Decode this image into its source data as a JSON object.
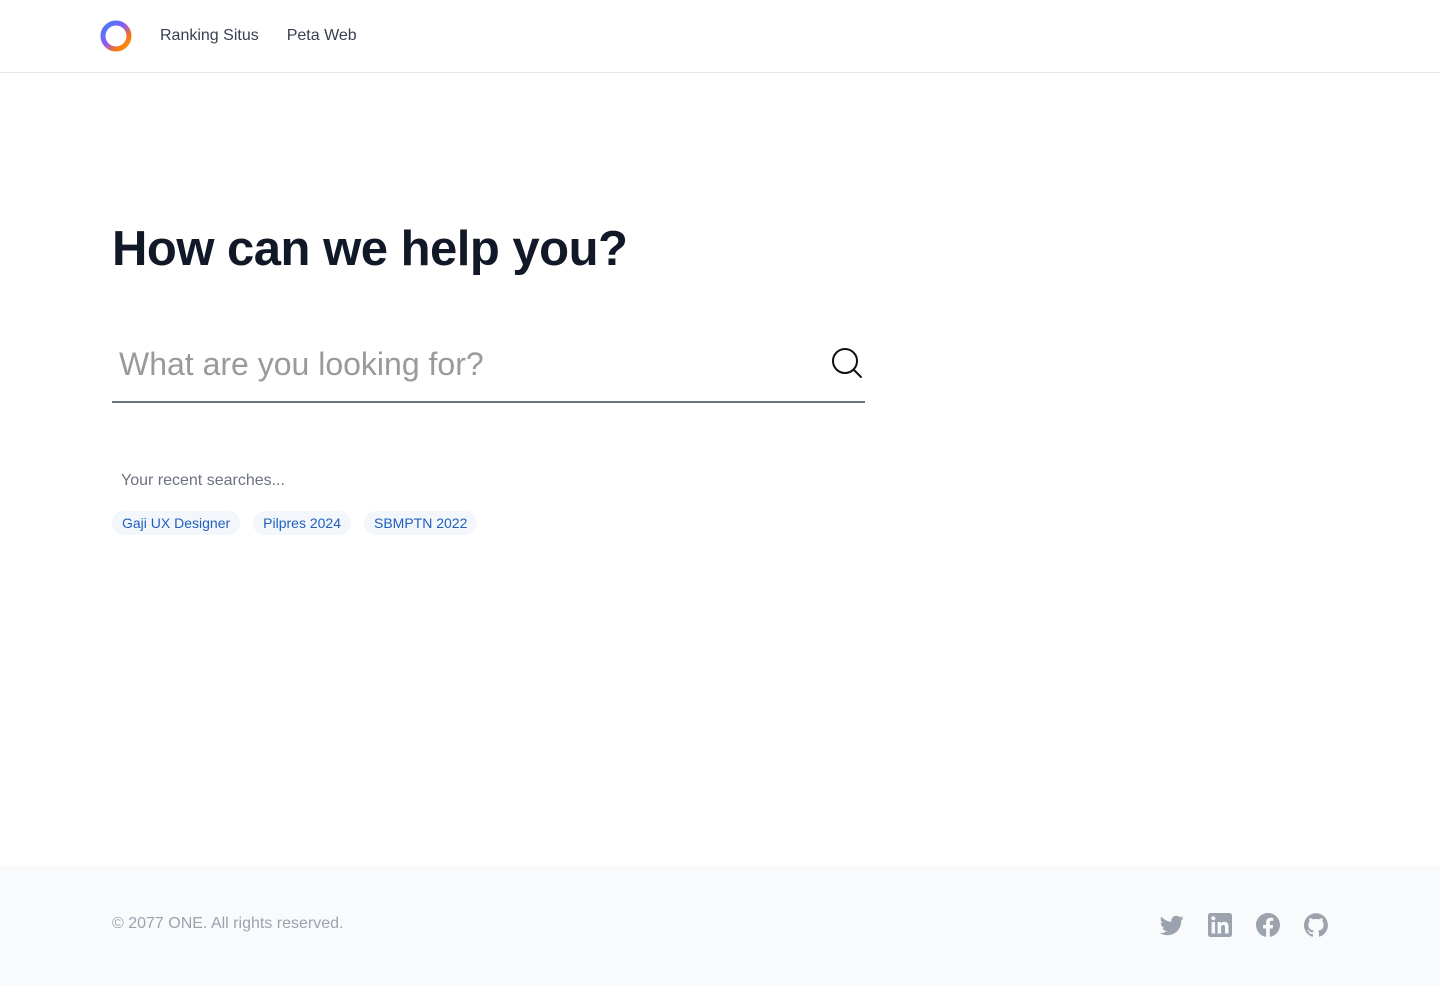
{
  "header": {
    "logo_icon": "ring-logo-icon",
    "nav": [
      {
        "label": "Ranking Situs"
      },
      {
        "label": "Peta Web"
      }
    ]
  },
  "main": {
    "title": "How can we help you?",
    "search": {
      "placeholder": "What are you looking for?",
      "value": "",
      "icon": "search-icon"
    },
    "recent_label": "Your recent searches...",
    "recent_searches": [
      "Gaji UX Designer",
      "Pilpres 2024",
      "SBMPTN 2022"
    ]
  },
  "footer": {
    "copyright": "© 2077 ONE. All rights reserved.",
    "socials": [
      "twitter-icon",
      "linkedin-icon",
      "facebook-icon",
      "github-icon"
    ]
  },
  "colors": {
    "title": "#111827",
    "chip_text": "#1f5fbf",
    "chip_bg": "#f3f6fb",
    "footer_bg": "#f9fafb",
    "muted": "#9ca3af"
  }
}
